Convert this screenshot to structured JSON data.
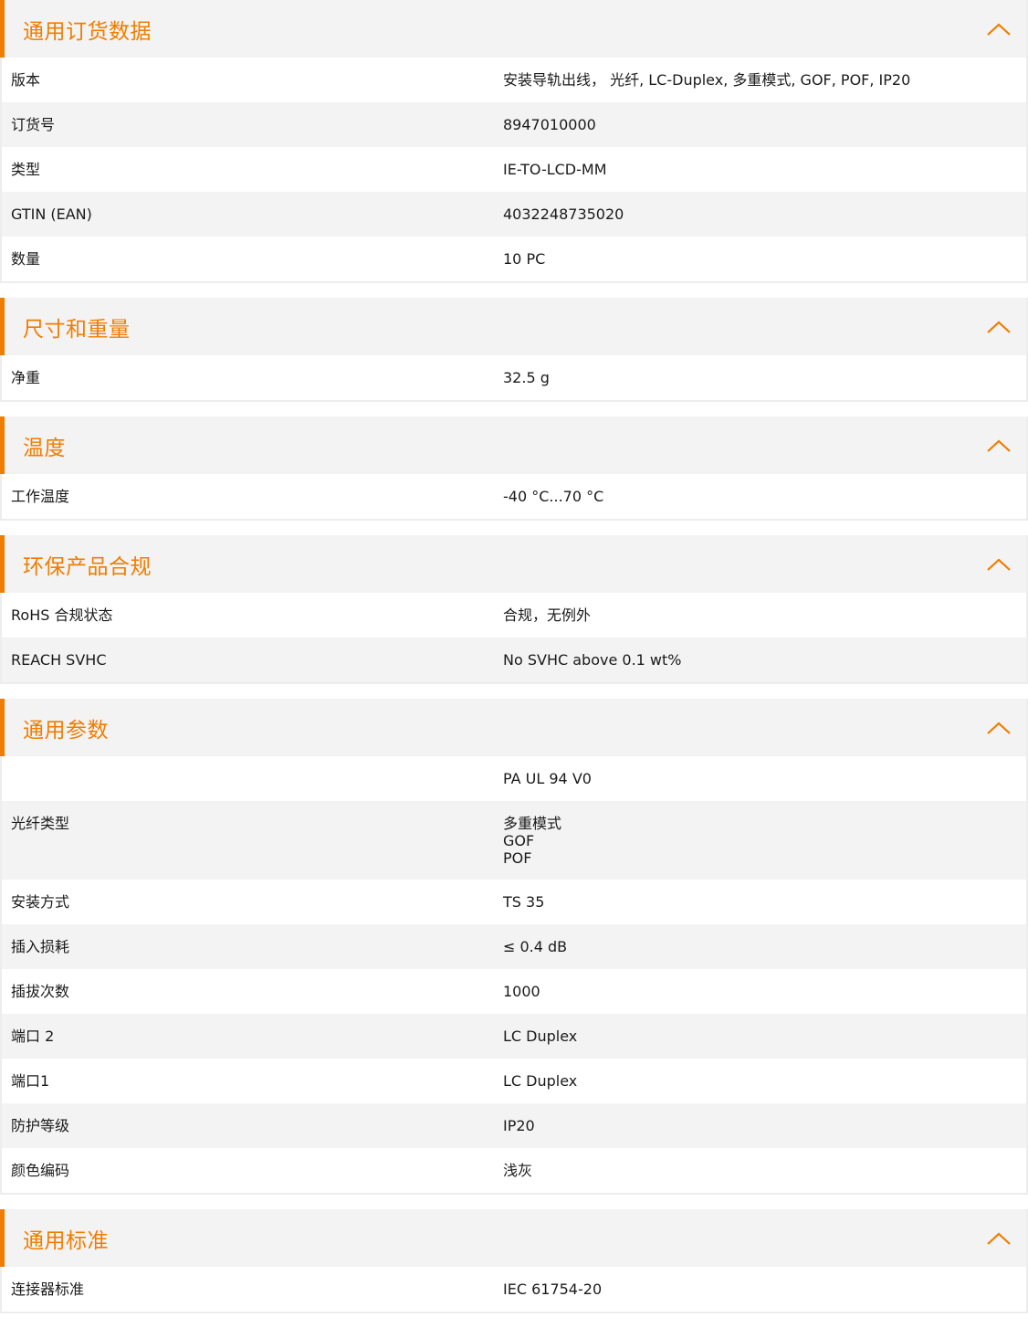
{
  "colors": {
    "accent": "#f07d00",
    "header_bg": "#f3f3f3",
    "row_alt_bg": "#f3f3f3"
  },
  "sections": [
    {
      "title": "通用订货数据",
      "icon": "chevron-up-icon",
      "rows": [
        {
          "label": "版本",
          "value": "安装导轨出线， 光纤, LC-Duplex, 多重模式, GOF, POF, IP20"
        },
        {
          "label": "订货号",
          "value": "8947010000"
        },
        {
          "label": "类型",
          "value": "IE-TO-LCD-MM"
        },
        {
          "label": "GTIN (EAN)",
          "value": "4032248735020"
        },
        {
          "label": "数量",
          "value": "10  PC"
        }
      ]
    },
    {
      "title": "尺寸和重量",
      "icon": "chevron-up-icon",
      "rows": [
        {
          "label": "净重",
          "value": "32.5  g"
        }
      ]
    },
    {
      "title": "温度",
      "icon": "chevron-up-icon",
      "rows": [
        {
          "label": "工作温度",
          "value": "-40 °C...70 °C"
        }
      ]
    },
    {
      "title": "环保产品合规",
      "icon": "chevron-up-icon",
      "rows": [
        {
          "label": "RoHS 合规状态",
          "value": "合规，无例外"
        },
        {
          "label": "REACH SVHC",
          "value": "No SVHC above 0.1 wt%"
        }
      ]
    },
    {
      "title": "通用参数",
      "icon": "chevron-up-icon",
      "rows": [
        {
          "label": "",
          "value": "PA UL 94 V0"
        },
        {
          "label": "光纤类型",
          "value": "多重模式\nGOF\nPOF"
        },
        {
          "label": "安装方式",
          "value": "TS 35"
        },
        {
          "label": "插入损耗",
          "value": "≤ 0.4 dB"
        },
        {
          "label": "插拔次数",
          "value": "1000"
        },
        {
          "label": "端口 2",
          "value": "LC Duplex"
        },
        {
          "label": "端口1",
          "value": "LC Duplex"
        },
        {
          "label": "防护等级",
          "value": "IP20"
        },
        {
          "label": "颜色编码",
          "value": "浅灰"
        }
      ]
    },
    {
      "title": "通用标准",
      "icon": "chevron-up-icon",
      "rows": [
        {
          "label": "连接器标准",
          "value": "IEC 61754-20"
        }
      ]
    }
  ]
}
